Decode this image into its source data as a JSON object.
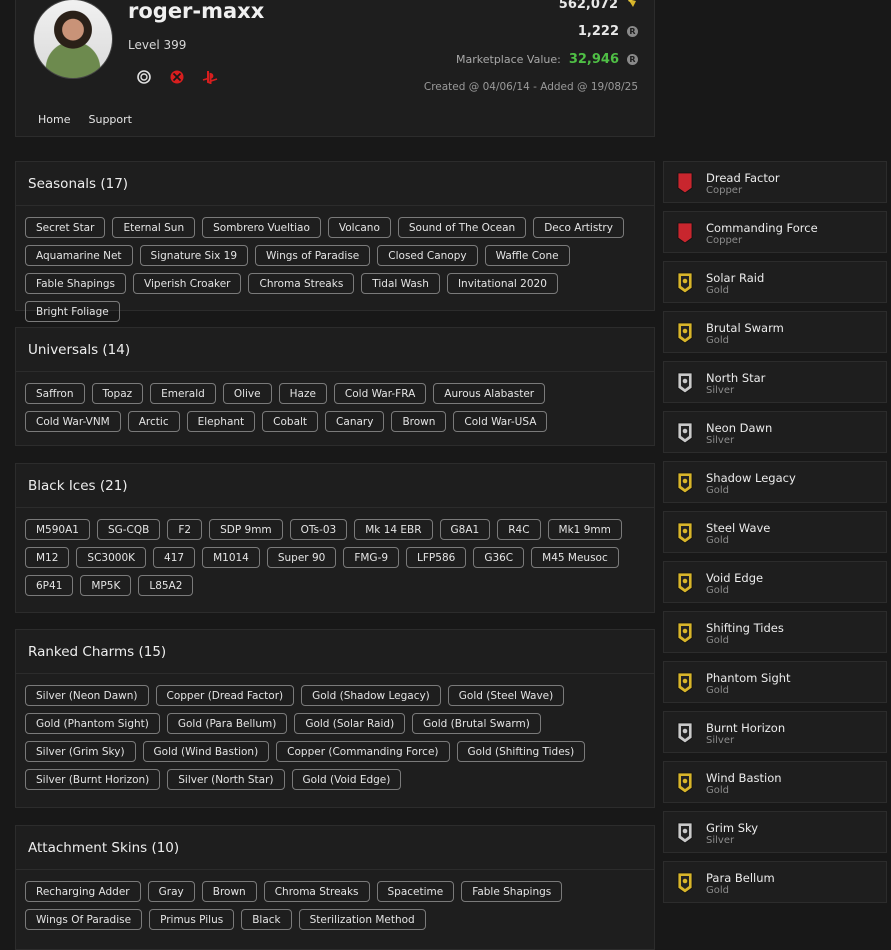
{
  "profile": {
    "username": "roger-maxx",
    "level": "Level 399",
    "platforms": [
      "ubisoft-icon",
      "xbox-icon",
      "playstation-icon"
    ],
    "renown": "562,072",
    "credits": "1,222",
    "marketplace_label": "Marketplace Value:",
    "marketplace_value": "32,946",
    "created": "Created @ 04/06/14 - Added @ 19/08/25",
    "nav": [
      "Home",
      "Support"
    ]
  },
  "sections": [
    {
      "title": "Seasonals (17)",
      "tags": [
        "Secret Star",
        "Eternal Sun",
        "Sombrero Vueltiao",
        "Volcano",
        "Sound of The Ocean",
        "Deco Artistry",
        "Aquamarine Net",
        "Signature Six 19",
        "Wings of Paradise",
        "Closed Canopy",
        "Waffle Cone",
        "Fable Shapings",
        "Viperish Croaker",
        "Chroma Streaks",
        "Tidal Wash",
        "Invitational 2020",
        "Bright Foliage"
      ]
    },
    {
      "title": "Universals (14)",
      "tags": [
        "Saffron",
        "Topaz",
        "Emerald",
        "Olive",
        "Haze",
        "Cold War-FRA",
        "Aurous Alabaster",
        "Cold War-VNM",
        "Arctic",
        "Elephant",
        "Cobalt",
        "Canary",
        "Brown",
        "Cold War-USA"
      ]
    },
    {
      "title": "Black Ices (21)",
      "tags": [
        "M590A1",
        "SG-CQB",
        "F2",
        "SDP 9mm",
        "OTs-03",
        "Mk 14 EBR",
        "G8A1",
        "R4C",
        "Mk1 9mm",
        "M12",
        "SC3000K",
        "417",
        "M1014",
        "Super 90",
        "FMG-9",
        "LFP586",
        "G36C",
        "M45 Meusoc",
        "6P41",
        "MP5K",
        "L85A2"
      ]
    },
    {
      "title": "Ranked Charms (15)",
      "tags": [
        "Silver (Neon Dawn)",
        "Copper (Dread Factor)",
        "Gold (Shadow Legacy)",
        "Gold (Steel Wave)",
        "Gold (Phantom Sight)",
        "Gold (Para Bellum)",
        "Gold (Solar Raid)",
        "Gold (Brutal Swarm)",
        "Silver (Grim Sky)",
        "Gold (Wind Bastion)",
        "Copper (Commanding Force)",
        "Gold (Shifting Tides)",
        "Silver (Burnt Horizon)",
        "Silver (North Star)",
        "Gold (Void Edge)"
      ]
    },
    {
      "title": "Attachment Skins (10)",
      "tags": [
        "Recharging Adder",
        "Gray",
        "Brown",
        "Chroma Streaks",
        "Spacetime",
        "Fable Shapings",
        "Wings Of Paradise",
        "Primus Pilus",
        "Black",
        "Sterilization Method"
      ]
    }
  ],
  "charms": [
    {
      "name": "Dread Factor",
      "tier": "Copper"
    },
    {
      "name": "Commanding Force",
      "tier": "Copper"
    },
    {
      "name": "Solar Raid",
      "tier": "Gold"
    },
    {
      "name": "Brutal Swarm",
      "tier": "Gold"
    },
    {
      "name": "North Star",
      "tier": "Silver"
    },
    {
      "name": "Neon Dawn",
      "tier": "Silver"
    },
    {
      "name": "Shadow Legacy",
      "tier": "Gold"
    },
    {
      "name": "Steel Wave",
      "tier": "Gold"
    },
    {
      "name": "Void Edge",
      "tier": "Gold"
    },
    {
      "name": "Shifting Tides",
      "tier": "Gold"
    },
    {
      "name": "Phantom Sight",
      "tier": "Gold"
    },
    {
      "name": "Burnt Horizon",
      "tier": "Silver"
    },
    {
      "name": "Wind Bastion",
      "tier": "Gold"
    },
    {
      "name": "Grim Sky",
      "tier": "Silver"
    },
    {
      "name": "Para Bellum",
      "tier": "Gold"
    }
  ],
  "colors": {
    "gold": "#d8b52a",
    "silver": "#c9c9c9",
    "copper": "#c8262e",
    "accent_green": "#4fbf45"
  }
}
